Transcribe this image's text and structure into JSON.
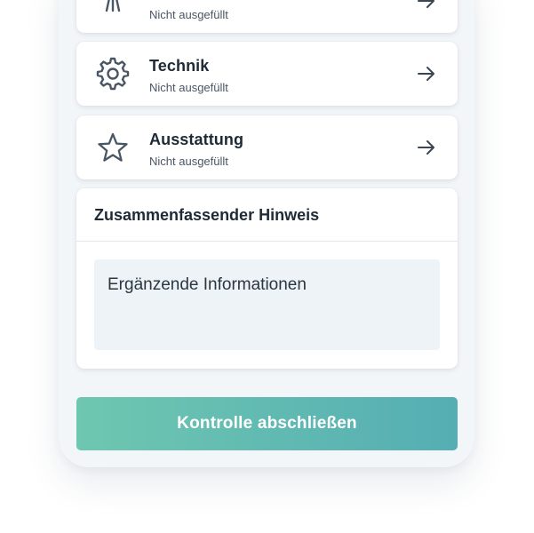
{
  "sections": [
    {
      "title": "",
      "status": "Nicht ausgefüllt",
      "icon": "seat-icon"
    },
    {
      "title": "Technik",
      "status": "Nicht ausgefüllt",
      "icon": "gear-icon"
    },
    {
      "title": "Ausstattung",
      "status": "Nicht ausgefüllt",
      "icon": "star-icon"
    }
  ],
  "note": {
    "title": "Zusammenfassender Hinweis",
    "placeholder": "Ergänzende Informationen"
  },
  "cta": {
    "label": "Kontrolle abschließen"
  },
  "colors": {
    "accent_start": "#6ec7b0",
    "accent_end": "#55aeb3",
    "background": "#f3f6f9"
  }
}
